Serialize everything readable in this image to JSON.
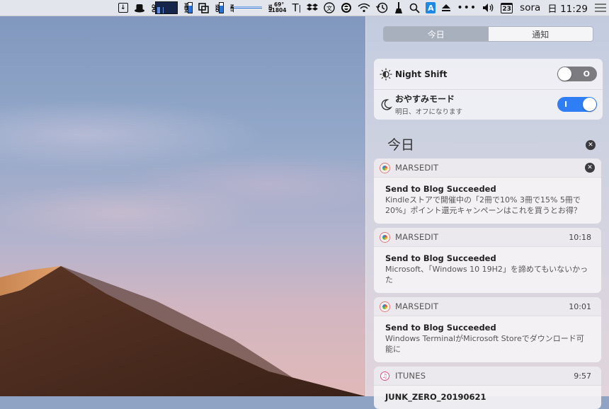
{
  "menubar": {
    "cpu_label": "CPU",
    "mem_label": "MEM",
    "ssd_label": "SSD",
    "net_label": "NET",
    "sen_label": "SEN",
    "temp_value": "69°",
    "fan_value": "1804",
    "text_icon_glyph": "T",
    "user": "sora",
    "clock": "日 11:29",
    "calendar_day": "23",
    "accent": "#1e88e5",
    "icons": [
      "download-icon",
      "hat-icon",
      "cpu-graph",
      "memory-meter",
      "copy-icon",
      "ssd-meter",
      "network-graph",
      "sensor-readout",
      "text-cursor-icon",
      "dropbox-icon",
      "translate-icon",
      "steering-icon",
      "wifi-icon",
      "time-machine-icon",
      "broom-icon",
      "search-icon",
      "atok-icon",
      "eject-icon",
      "more-icon",
      "volume-icon",
      "calendar-icon",
      "notification-center-icon"
    ]
  },
  "panel": {
    "tabs": {
      "today": "今日",
      "notifications": "通知"
    },
    "night_shift": {
      "label": "Night Shift",
      "state": "off",
      "mark": "O"
    },
    "dnd": {
      "label": "おやすみモード",
      "sub": "明日、オフになります",
      "state": "on",
      "mark": "I"
    },
    "section_title": "今日",
    "cards": [
      {
        "app": "MARSEDIT",
        "icon": "marsedit-icon",
        "time": "",
        "title": "Send to Blog Succeeded",
        "message": "Kindleストアで開催中の「2冊で10% 3冊で15% 5冊で20%」ポイント還元キャンペーンはこれを買うとお得？"
      },
      {
        "app": "MARSEDIT",
        "icon": "marsedit-icon",
        "time": "10:18",
        "title": "Send to Blog Succeeded",
        "message": "Microsoft、「Windows 10 19H2」を諦めてもいないかった"
      },
      {
        "app": "MARSEDIT",
        "icon": "marsedit-icon",
        "time": "10:01",
        "title": "Send to Blog Succeeded",
        "message": "Windows TerminalがMicrosoft Storeでダウンロード可能に"
      },
      {
        "app": "ITUNES",
        "icon": "itunes-icon",
        "time": "9:57",
        "title": "JUNK_ZERO_20190621",
        "message": ""
      }
    ]
  }
}
